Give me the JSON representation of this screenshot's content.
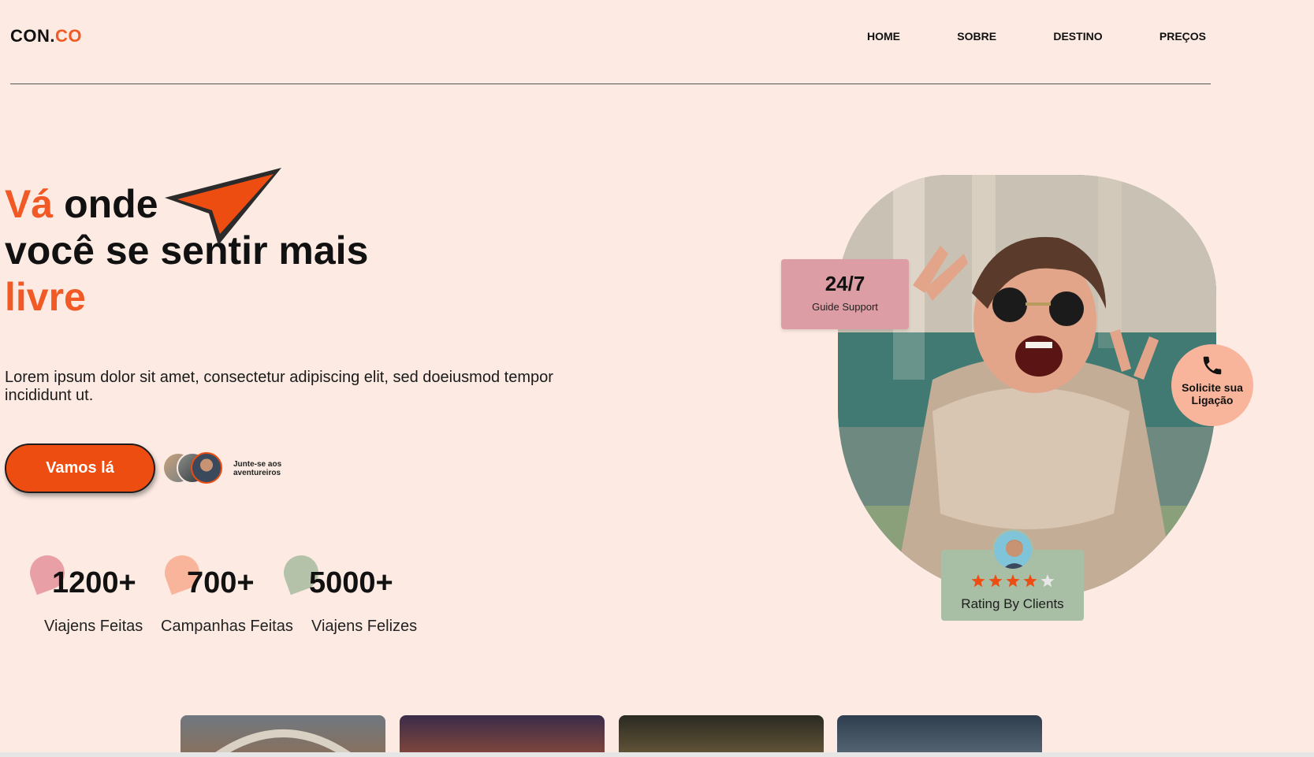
{
  "header": {
    "logo_main": "CON.",
    "logo_accent": "CO",
    "nav": [
      "HOME",
      "SOBRE",
      "DESTINO",
      "PREÇOS"
    ]
  },
  "hero": {
    "title_accent_1": "Vá",
    "title_1": " onde",
    "title_2": "você se sentir mais",
    "title_accent_3": "livre",
    "description": "Lorem ipsum dolor sit amet, consectetur adipiscing elit, sed doeiusmod tempor incididunt ut.",
    "cta_label": "Vamos lá",
    "join_text": "Junte-se aos aventureiros"
  },
  "stats": [
    {
      "value": "1200+",
      "label": "Viajens Feitas",
      "color": "#e8a0a6"
    },
    {
      "value": "700+",
      "label": "Campanhas Feitas",
      "color": "#f9b59b"
    },
    {
      "value": "5000+",
      "label": "Viajens Felizes",
      "color": "#b4c2a9"
    }
  ],
  "cards": {
    "support_big": "24/7",
    "support_small": "Guide Support",
    "call_label": "Solicite sua Ligação",
    "rating_label": "Rating By Clients",
    "rating_stars": 4,
    "rating_max": 5
  },
  "colors": {
    "background": "#fdebe3",
    "accent": "#f15a24",
    "support_card": "#dc9da4",
    "rating_card": "#a8bfa6",
    "call_button": "#f9b59b"
  }
}
